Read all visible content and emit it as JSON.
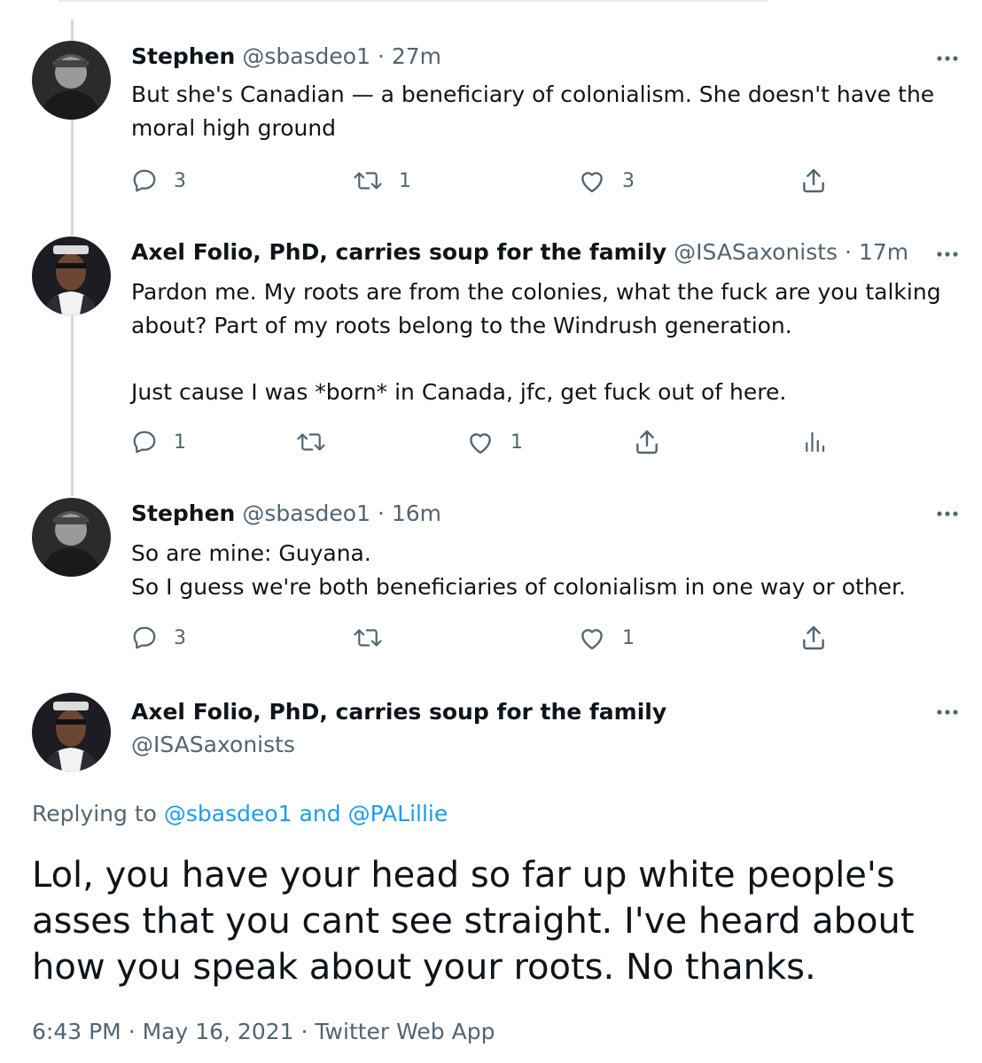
{
  "tweets": [
    {
      "name": "Stephen",
      "handle": "@sbasdeo1",
      "time": "· 27m",
      "text": "But she's Canadian — a beneficiary of colonialism. She doesn't have the moral high ground",
      "replies": "3",
      "retweets": "1",
      "likes": "3"
    },
    {
      "name": "Axel Folio, PhD, carries soup for the family",
      "handle": "@ISASaxonists",
      "time": "· 17m",
      "text": "Pardon me. My roots are from the colonies, what the fuck are you talking about? Part of my roots belong to the Windrush generation.\n\nJust cause I was *born* in Canada, jfc, get fuck out of here.",
      "replies": "1",
      "retweets": "",
      "likes": "1"
    },
    {
      "name": "Stephen",
      "handle": "@sbasdeo1",
      "time": "· 16m",
      "text": "So are mine: Guyana.\nSo I guess we're both beneficiaries of colonialism in one way or other.",
      "replies": "3",
      "retweets": "",
      "likes": "1"
    }
  ],
  "main_tweet": {
    "name": "Axel Folio, PhD, carries soup for the family",
    "handle": "@ISASaxonists",
    "replying_prefix": "Replying to",
    "replying_to_1": "@sbasdeo1",
    "replying_and": "and",
    "replying_to_2": "@PALillie",
    "text": "Lol, you have your head so far up white people's asses that you cant see straight. I've heard about how you speak about your roots. No thanks.",
    "time": "6:43 PM",
    "date": "May 16, 2021",
    "source": "Twitter Web App",
    "separator": "·"
  },
  "icons": {
    "reply": "reply-icon",
    "retweet": "retweet-icon",
    "like": "like-icon",
    "share": "share-icon",
    "analytics": "analytics-icon",
    "more": "more-icon"
  },
  "colors": {
    "text": "#0f1419",
    "secondary": "#536471",
    "link": "#1d9bf0",
    "thread_line": "#cfd9de"
  }
}
